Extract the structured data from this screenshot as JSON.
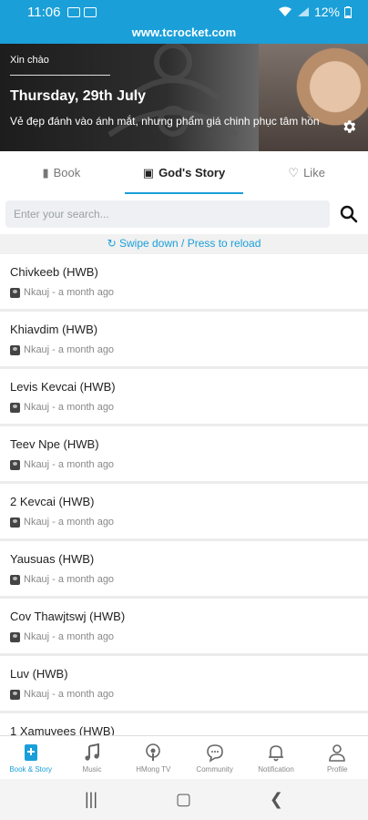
{
  "status_bar": {
    "time": "11:06",
    "battery": "12%"
  },
  "browser": {
    "url": "www.tcrocket.com"
  },
  "hero": {
    "greeting": "Xin chào",
    "date": "Thursday, 29th July",
    "quote": "Vẻ đẹp đánh vào ánh mắt, nhưng phẩm giá chinh phục tâm hồn"
  },
  "tabs": [
    {
      "label": "Book",
      "icon": "book-icon"
    },
    {
      "label": "God's Story",
      "icon": "bible-icon"
    },
    {
      "label": "Like",
      "icon": "heart-icon"
    }
  ],
  "search": {
    "placeholder": "Enter your search..."
  },
  "reload_hint": "Swipe down / Press to reload",
  "stories": [
    {
      "title": "Chivkeeb (HWB)",
      "meta": "Nkauj - a month ago"
    },
    {
      "title": "Khiavdim (HWB)",
      "meta": "Nkauj - a month ago"
    },
    {
      "title": "Levis Kevcai (HWB)",
      "meta": "Nkauj - a month ago"
    },
    {
      "title": "Teev Npe (HWB)",
      "meta": "Nkauj - a month ago"
    },
    {
      "title": "2 Kevcai (HWB)",
      "meta": "Nkauj - a month ago"
    },
    {
      "title": "Yausuas (HWB)",
      "meta": "Nkauj - a month ago"
    },
    {
      "title": "Cov Thawjtswj (HWB)",
      "meta": "Nkauj - a month ago"
    },
    {
      "title": "Luv (HWB)",
      "meta": "Nkauj - a month ago"
    },
    {
      "title": "1 Xamuyees (HWB)",
      "meta": ""
    }
  ],
  "bottom_nav": [
    {
      "label": "Book & Story",
      "icon": "book-story-icon"
    },
    {
      "label": "Music",
      "icon": "music-note-icon"
    },
    {
      "label": "HMong TV",
      "icon": "podcast-icon"
    },
    {
      "label": "Community",
      "icon": "chat-bubble-icon"
    },
    {
      "label": "Notification",
      "icon": "bell-icon"
    },
    {
      "label": "Profile",
      "icon": "person-icon"
    }
  ],
  "colors": {
    "accent": "#1a9fd9"
  }
}
